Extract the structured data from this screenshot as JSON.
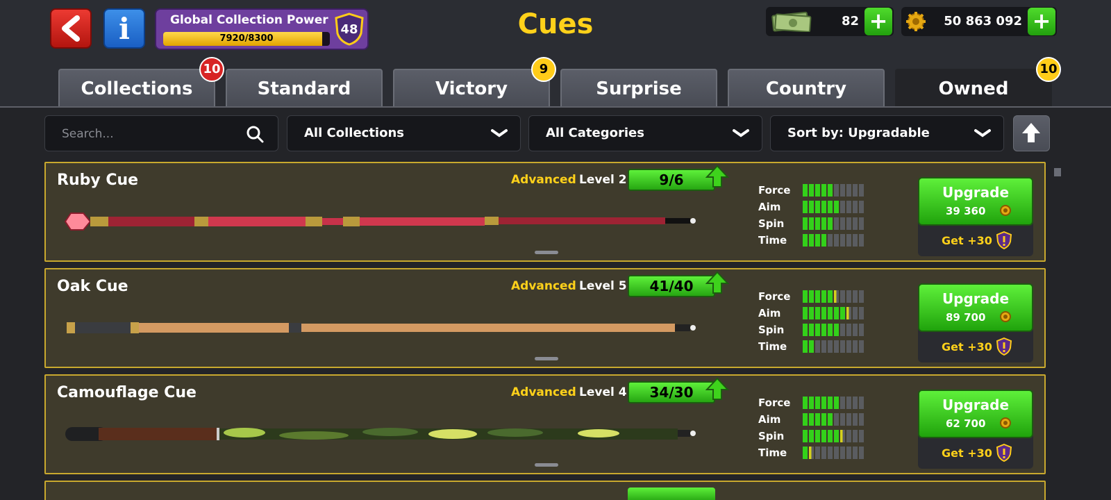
{
  "header": {
    "title": "Cues",
    "global_power": {
      "label": "Global Collection Power",
      "value_text": "7920/8300",
      "current": 7920,
      "max": 8300,
      "level": "48"
    },
    "cash": {
      "amount": "82"
    },
    "coins": {
      "amount": "50 863 092"
    }
  },
  "tabs": [
    {
      "label": "Collections",
      "badge": "10",
      "badge_color": "red"
    },
    {
      "label": "Standard",
      "badge": ""
    },
    {
      "label": "Victory",
      "badge": "9",
      "badge_color": "yellow"
    },
    {
      "label": "Surprise",
      "badge": ""
    },
    {
      "label": "Country",
      "badge": ""
    },
    {
      "label": "Owned",
      "badge": "10",
      "badge_color": "yellow",
      "active": true
    }
  ],
  "filters": {
    "search_placeholder": "Search...",
    "collection": "All Collections",
    "category": "All Categories",
    "sort": "Sort by: Upgradable"
  },
  "cues": [
    {
      "name": "Ruby Cue",
      "tier": "Advanced",
      "level": "Level 2",
      "progress": "9/6",
      "stats": [
        {
          "label": "Force",
          "filled": 5,
          "partial": false
        },
        {
          "label": "Aim",
          "filled": 6,
          "partial": false
        },
        {
          "label": "Spin",
          "filled": 5,
          "partial": false
        },
        {
          "label": "Time",
          "filled": 4,
          "partial": false
        }
      ],
      "upgrade_label": "Upgrade",
      "price": "39 360",
      "get_label": "Get +30"
    },
    {
      "name": "Oak Cue",
      "tier": "Advanced",
      "level": "Level 5",
      "progress": "41/40",
      "stats": [
        {
          "label": "Force",
          "filled": 5,
          "partial": true
        },
        {
          "label": "Aim",
          "filled": 7,
          "partial": true
        },
        {
          "label": "Spin",
          "filled": 6,
          "partial": false
        },
        {
          "label": "Time",
          "filled": 2,
          "partial": false
        }
      ],
      "upgrade_label": "Upgrade",
      "price": "89 700",
      "get_label": "Get +30"
    },
    {
      "name": "Camouflage Cue",
      "tier": "Advanced",
      "level": "Level 4",
      "progress": "34/30",
      "stats": [
        {
          "label": "Force",
          "filled": 6,
          "partial": false
        },
        {
          "label": "Aim",
          "filled": 5,
          "partial": false
        },
        {
          "label": "Spin",
          "filled": 6,
          "partial": true
        },
        {
          "label": "Time",
          "filled": 1,
          "partial": true
        }
      ],
      "upgrade_label": "Upgrade",
      "price": "62 700",
      "get_label": "Get +30"
    }
  ],
  "colors": {
    "accent_yellow": "#ffd11a",
    "upgrade_green": "#33d11a",
    "card_border": "#c9a92e",
    "card_bg": "#3f3b2c",
    "ruby_cue": "#c8324a",
    "oak_cue": "#d49a62",
    "camo_cue": "#4a6a2e"
  },
  "icons": [
    "back-arrow-icon",
    "info-icon",
    "shield-icon",
    "cash-icon",
    "coin-icon",
    "plus-icon",
    "search-icon",
    "chevron-down-icon",
    "sort-arrow-icon",
    "up-arrow-icon",
    "exclamation-shield-icon"
  ]
}
